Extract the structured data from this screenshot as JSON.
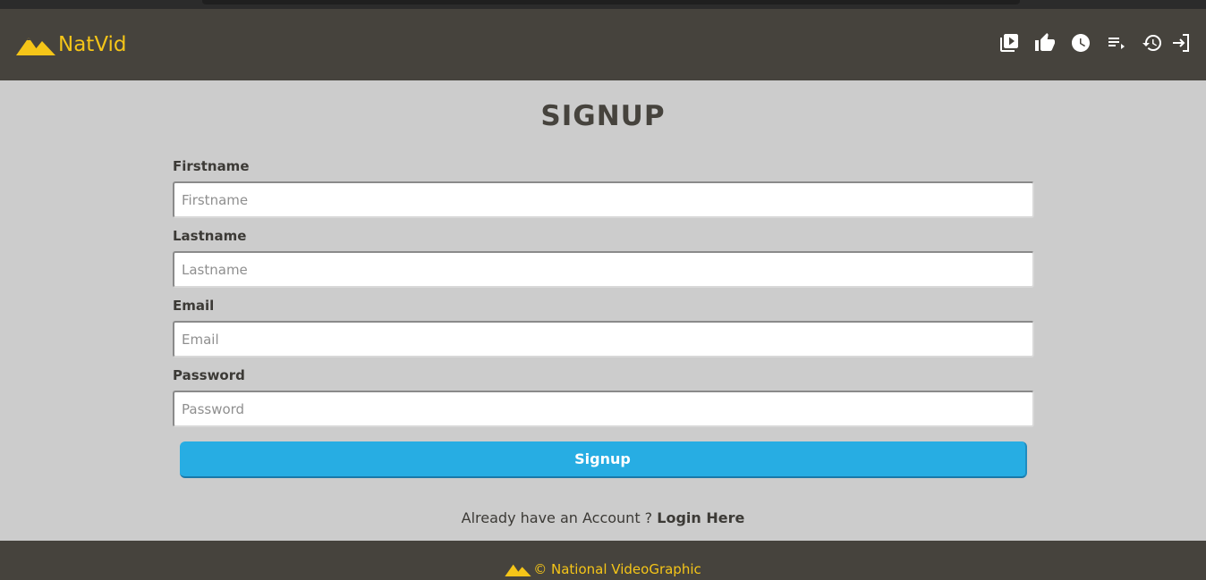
{
  "brand": {
    "name": "NatVid",
    "logo_icon": "mountain-logo-icon",
    "color": "#f5c518"
  },
  "nav": {
    "icons": [
      "video-library-icon",
      "thumbs-up-icon",
      "clock-icon",
      "playlist-icon",
      "history-icon",
      "login-icon"
    ]
  },
  "page": {
    "title": "SIGNUP"
  },
  "form": {
    "firstname": {
      "label": "Firstname",
      "placeholder": "Firstname",
      "value": ""
    },
    "lastname": {
      "label": "Lastname",
      "placeholder": "Lastname",
      "value": ""
    },
    "email": {
      "label": "Email",
      "placeholder": "Email",
      "value": ""
    },
    "password": {
      "label": "Password",
      "placeholder": "Password",
      "value": ""
    },
    "submit_label": "Signup"
  },
  "login_prompt": {
    "text": "Already have an Account ? ",
    "link_label": "Login Here"
  },
  "footer": {
    "text": "© National VideoGraphic"
  },
  "colors": {
    "navbar_bg": "#46433d",
    "page_bg": "#cccccc",
    "accent_yellow": "#f5c518",
    "button_blue": "#27ade3"
  }
}
